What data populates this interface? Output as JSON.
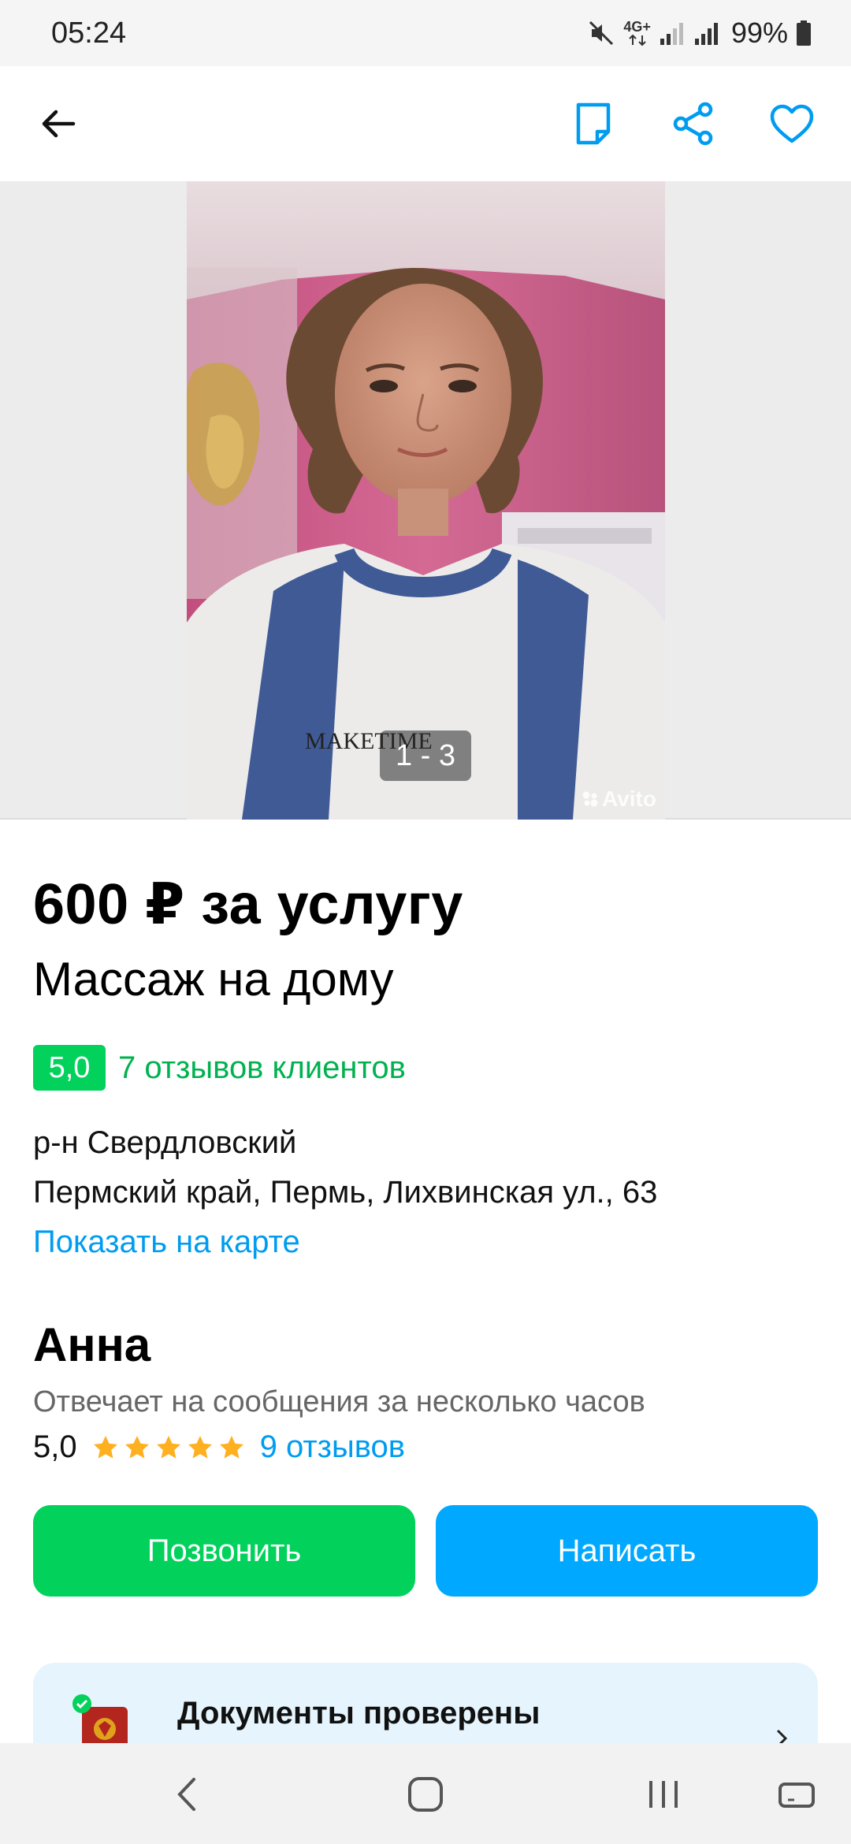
{
  "status_bar": {
    "time": "05:24",
    "network": "4G+",
    "battery": "99%"
  },
  "toolbar": {
    "back_icon": "arrow-left-icon",
    "actions": [
      "note-icon",
      "share-icon",
      "heart-icon"
    ],
    "accent_color": "#009cf0"
  },
  "gallery": {
    "counter": "1 - 3",
    "watermark": "Avito",
    "shirt_print": "MAKETIME"
  },
  "listing": {
    "price": "600 ₽ за услугу",
    "title": "Массаж на дому",
    "rating": "5,0",
    "reviews_link": "7 отзывов клиентов",
    "district": "р-н Свердловский",
    "address": "Пермский край, Пермь, Лихвинская ул., 63",
    "map_link": "Показать на карте"
  },
  "seller": {
    "name": "Анна",
    "response_time": "Отвечает на сообщения за несколько часов",
    "score": "5,0",
    "stars": 5,
    "reviews": "9 отзывов"
  },
  "actions": {
    "call": "Позвонить",
    "write": "Написать"
  },
  "docs": {
    "title": "Документы проверены"
  },
  "colors": {
    "green": "#02d15c",
    "blue": "#00a9ff",
    "link": "#009cf0",
    "star": "#ffb021"
  }
}
